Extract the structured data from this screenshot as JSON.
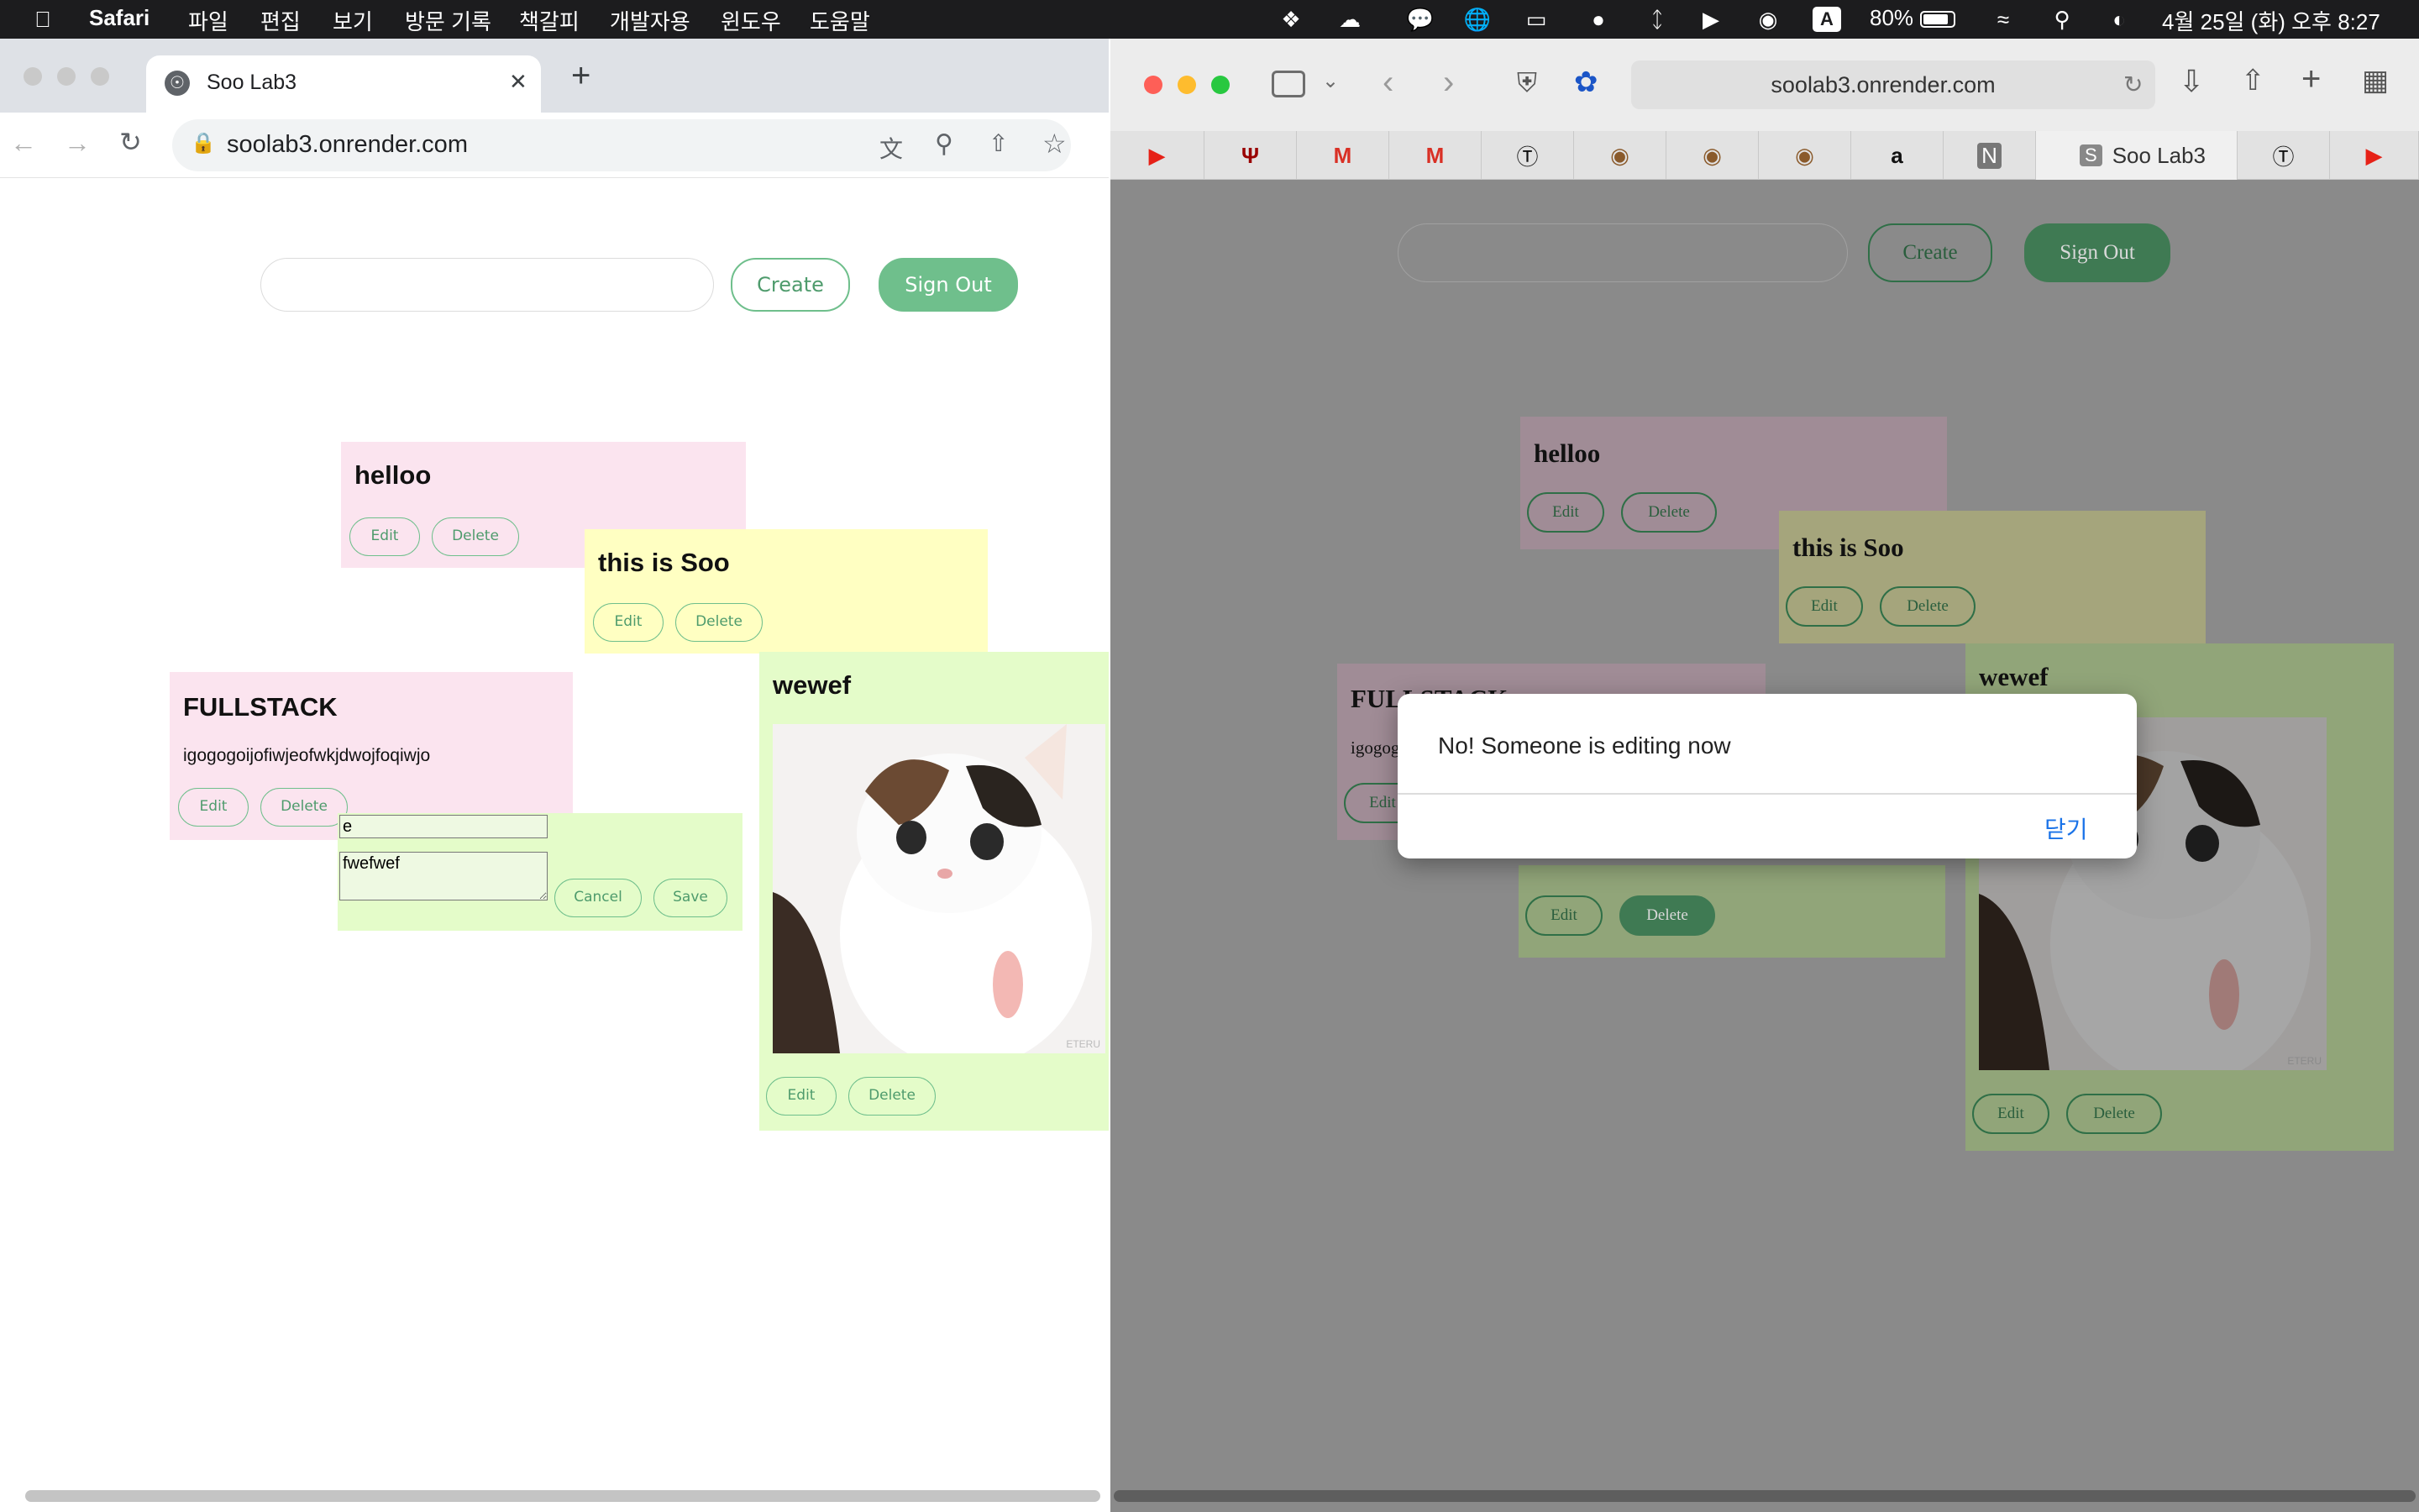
{
  "menubar": {
    "app": "Safari",
    "items": [
      "파일",
      "편집",
      "보기",
      "방문 기록",
      "책갈피",
      "개발자용",
      "윈도우",
      "도움말"
    ],
    "battery": "80%",
    "datetime": "4월 25일 (화) 오후 8:27",
    "input_indicator": "A"
  },
  "left_browser": {
    "tab_title": "Soo Lab3",
    "url": "soolab3.onrender.com",
    "new_tab": "+",
    "close_tab": "✕"
  },
  "app": {
    "create_label": "Create",
    "signout_label": "Sign Out",
    "edit_label": "Edit",
    "delete_label": "Delete",
    "cancel_label": "Cancel",
    "save_label": "Save",
    "notes": [
      {
        "title": "helloo",
        "body": "",
        "color": "#fbe4ef"
      },
      {
        "title": "this is Soo",
        "body": "",
        "color": "#ffffc2"
      },
      {
        "title": "FULLSTACK",
        "body": "igogogoijofiwjeofwkjdwojfoqiwjo",
        "color": "#fbe4ef"
      },
      {
        "title": "wewef",
        "body": "",
        "color": "#e4fcc9",
        "image_watermark": "ETERU"
      }
    ],
    "editing_note": {
      "title_value": "e",
      "body_value": "fwefwef",
      "color": "#e4fcc9"
    }
  },
  "right_browser": {
    "url": "soolab3.onrender.com",
    "active_tab": "Soo Lab3",
    "favorites": [
      "youtube-icon",
      "iu-icon",
      "gmail-icon",
      "gmail-icon",
      "k-icon",
      "bear-icon",
      "bear-icon",
      "bear-icon",
      "amazon-icon",
      "notion-icon"
    ]
  },
  "dialog": {
    "message": "No! Someone is editing now",
    "close_label": "닫기"
  }
}
